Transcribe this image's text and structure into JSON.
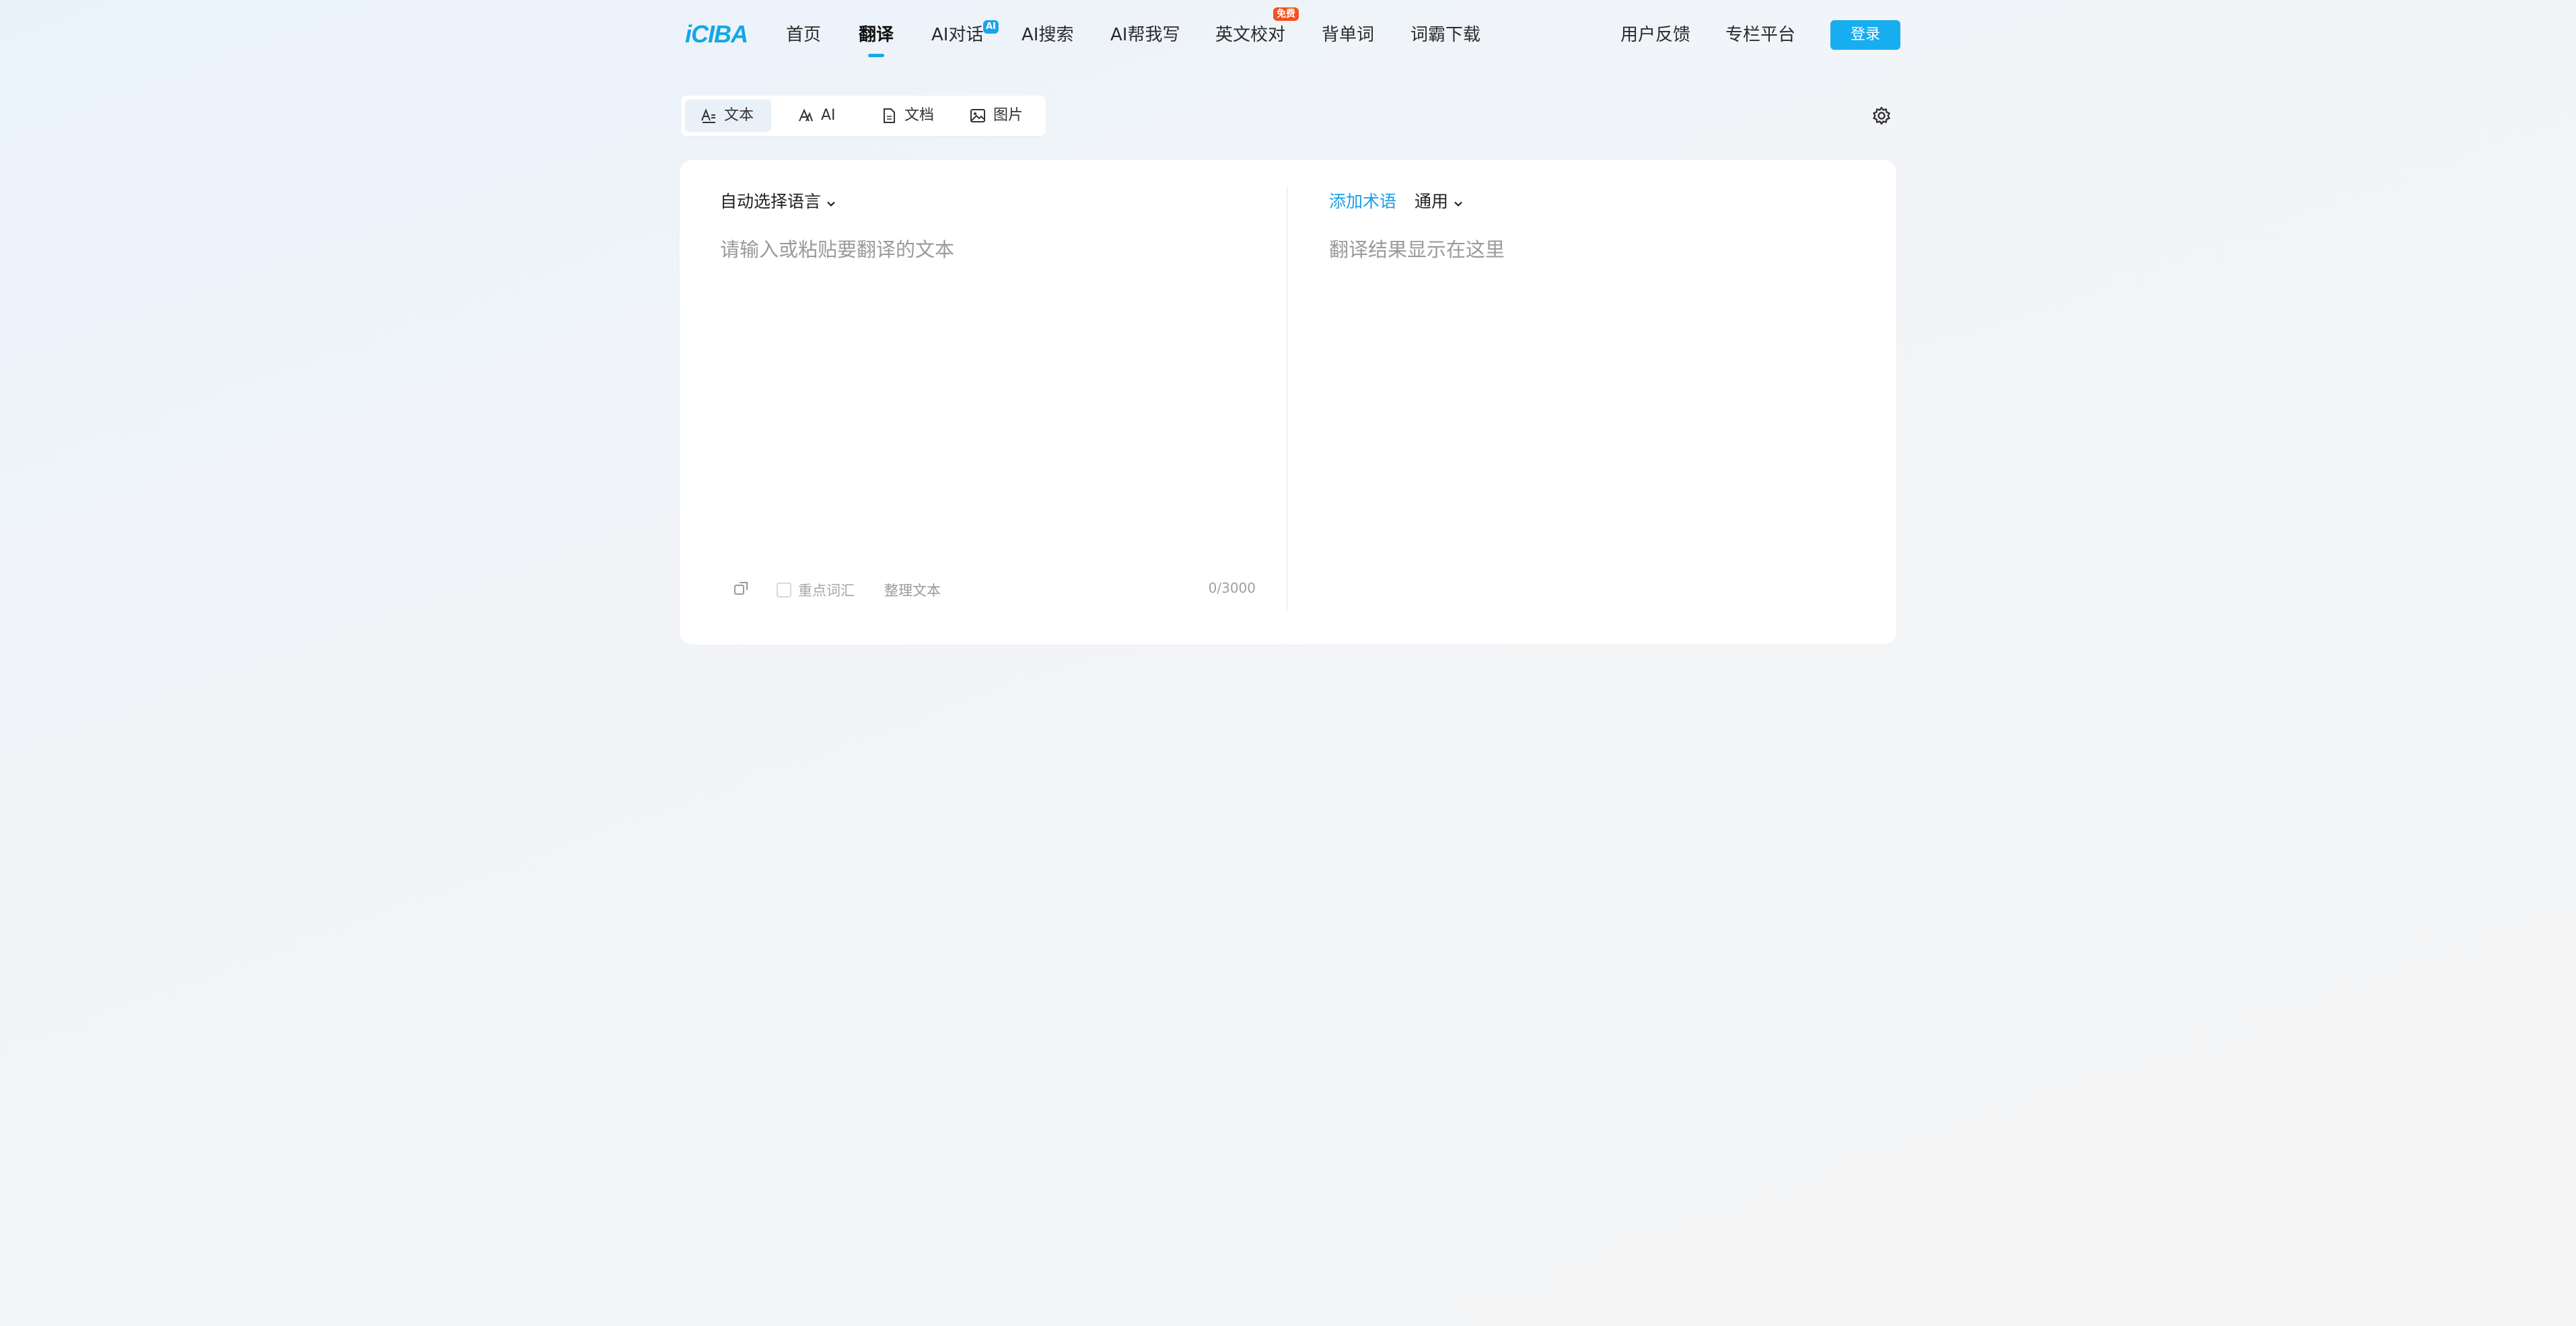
{
  "brand": {
    "logo_text": "iCIBA",
    "accent_color": "#17aef0",
    "badge_red": "#f4511e"
  },
  "nav": {
    "items": [
      {
        "label": "首页"
      },
      {
        "label": "翻译",
        "active": true
      },
      {
        "label": "AI对话",
        "badge": "AI"
      },
      {
        "label": "AI搜索"
      },
      {
        "label": "AI帮我写"
      },
      {
        "label": "英文校对",
        "badge": "免费"
      },
      {
        "label": "背单词"
      },
      {
        "label": "词霸下载"
      }
    ],
    "right": [
      {
        "label": "用户反馈"
      },
      {
        "label": "专栏平台"
      }
    ],
    "login_label": "登录"
  },
  "modes": {
    "tabs": [
      {
        "label": "文本",
        "icon": "text-translate-icon",
        "active": true
      },
      {
        "label": "AI",
        "icon": "ai-icon"
      },
      {
        "label": "文档",
        "icon": "document-icon"
      },
      {
        "label": "图片",
        "icon": "image-icon"
      }
    ],
    "settings_icon": "gear-icon"
  },
  "source": {
    "language_label": "自动选择语言",
    "placeholder": "请输入或粘贴要翻译的文本",
    "key_vocab_label": "重点词汇",
    "key_vocab_checked": false,
    "tidy_label": "整理文本",
    "char_count": "0/3000"
  },
  "target": {
    "add_term_label": "添加术语",
    "domain_label": "通用",
    "placeholder": "翻译结果显示在这里"
  }
}
